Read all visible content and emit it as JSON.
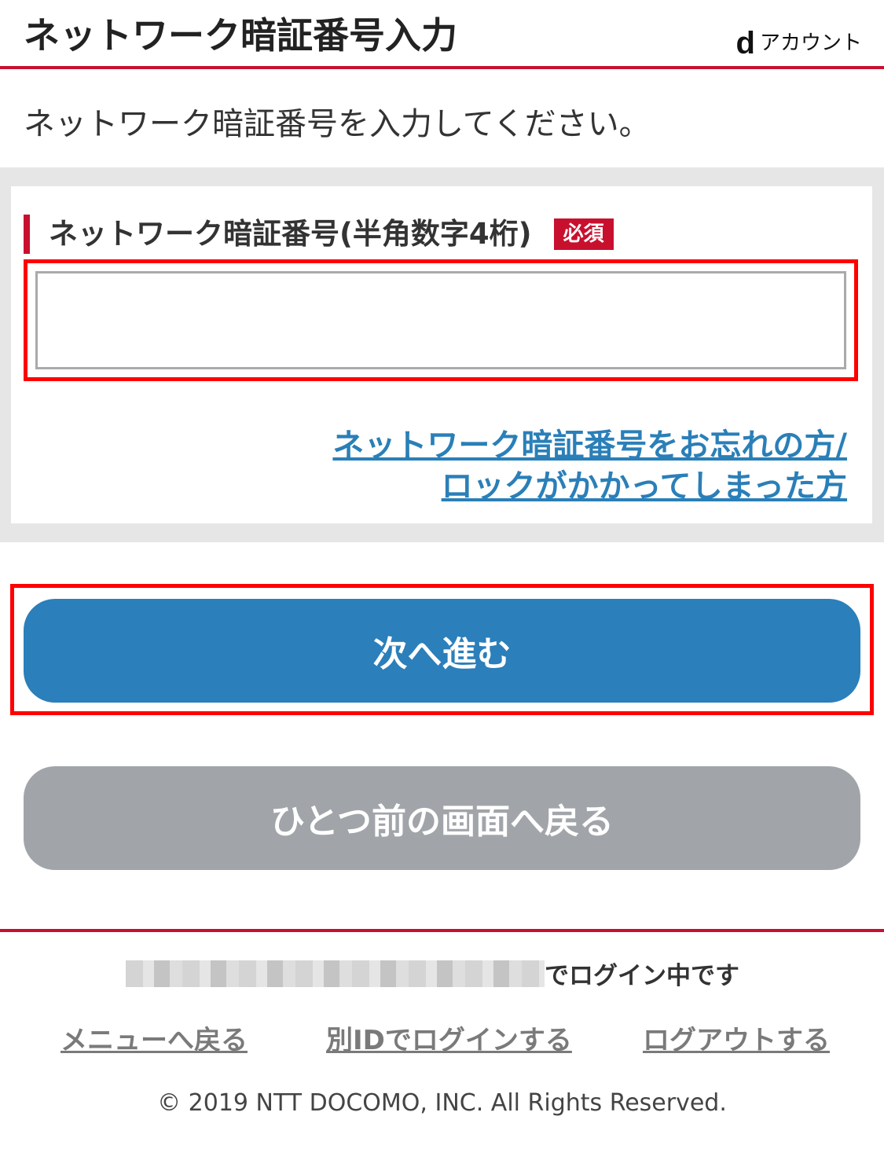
{
  "header": {
    "title": "ネットワーク暗証番号入力",
    "brand_mark": "d",
    "brand_text": "アカウント"
  },
  "instruction": "ネットワーク暗証番号を入力してください。",
  "form": {
    "field_label": "ネットワーク暗証番号(半角数字4桁)",
    "required_badge": "必須",
    "pin_value": "",
    "forgot_link_line1": "ネットワーク暗証番号をお忘れの方/",
    "forgot_link_line2": "ロックがかかってしまった方"
  },
  "buttons": {
    "next_label": "次へ進む",
    "back_label": "ひとつ前の画面へ戻る"
  },
  "footer": {
    "login_status": "でログイン中です",
    "menu_link": "メニューへ戻る",
    "other_id_link": "別IDでログインする",
    "logout_link": "ログアウトする",
    "copyright": "© 2019 NTT DOCOMO, INC. All Rights Reserved."
  },
  "colors": {
    "accent_red": "#c8102e",
    "primary_button": "#2b7fba",
    "secondary_button": "#a1a5a9",
    "link_blue": "#2a7fb8",
    "highlight_red": "#ff0000"
  }
}
